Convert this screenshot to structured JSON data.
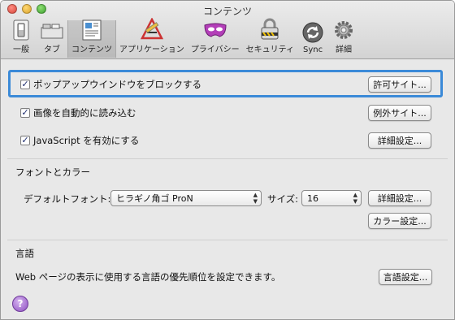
{
  "window": {
    "title": "コンテンツ"
  },
  "toolbar": {
    "items": [
      {
        "label": "一般",
        "icon": "switch-icon"
      },
      {
        "label": "タブ",
        "icon": "tabs-icon"
      },
      {
        "label": "コンテンツ",
        "icon": "content-icon",
        "selected": true
      },
      {
        "label": "アプリケーション",
        "icon": "applications-icon"
      },
      {
        "label": "プライバシー",
        "icon": "privacy-mask-icon"
      },
      {
        "label": "セキュリティ",
        "icon": "lock-icon"
      },
      {
        "label": "Sync",
        "icon": "sync-icon"
      },
      {
        "label": "詳細",
        "icon": "gear-icon"
      }
    ]
  },
  "content": {
    "popup": {
      "label": "ポップアップウインドウをブロックする",
      "checked": true,
      "button": "許可サイト..."
    },
    "images": {
      "label": "画像を自動的に読み込む",
      "checked": true,
      "button": "例外サイト..."
    },
    "javascript": {
      "label": "JavaScript を有効にする",
      "checked": true,
      "button": "詳細設定..."
    },
    "fonts": {
      "title": "フォントとカラー",
      "default_font_label": "デフォルトフォント:",
      "default_font_value": "ヒラギノ角ゴ ProN",
      "size_label": "サイズ:",
      "size_value": "16",
      "advanced_button": "詳細設定...",
      "colors_button": "カラー設定..."
    },
    "languages": {
      "title": "言語",
      "description": "Web ページの表示に使用する言語の優先順位を設定できます。",
      "button": "言語設定..."
    }
  },
  "help": {
    "label": "?"
  },
  "colors": {
    "focus_ring": "#3b8ad8",
    "help": "#9b59c9"
  }
}
